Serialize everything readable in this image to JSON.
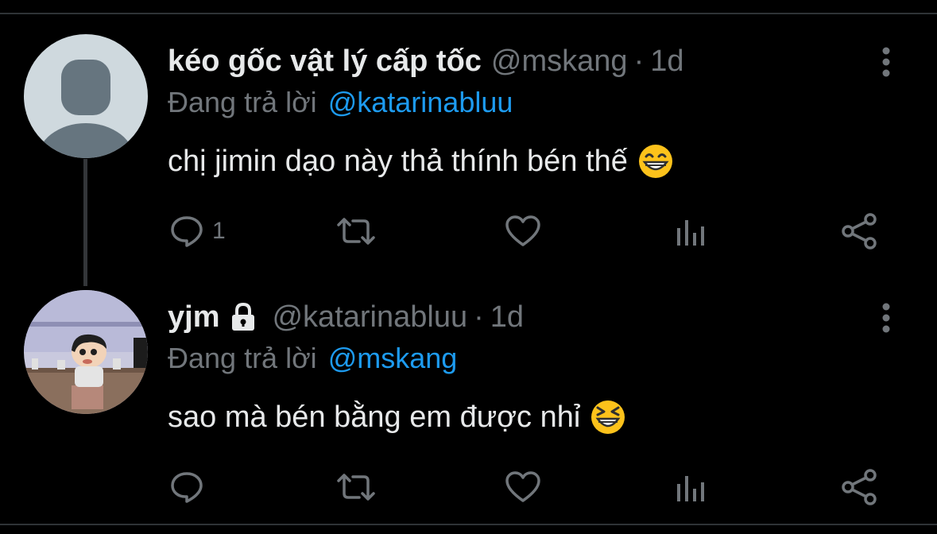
{
  "colors": {
    "background": "#000000",
    "text": "#e7e9ea",
    "muted": "#71767b",
    "link": "#1d9bf0",
    "divider": "#2f3336"
  },
  "tweets": [
    {
      "display_name": "kéo gốc vật lý cấp tốc",
      "handle": "@mskang",
      "separator": "·",
      "time": "1d",
      "reply_prefix": "Đang trả lời",
      "reply_to": "@katarinabluu",
      "text": "chị jimin dạo này thả thính bén thế",
      "emoji": "grinning-face-icon",
      "reply_count": "1",
      "avatar": "default-avatar",
      "locked": false
    },
    {
      "display_name": "yjm",
      "handle": "@katarinabluu",
      "separator": "·",
      "time": "1d",
      "reply_prefix": "Đang trả lời",
      "reply_to": "@mskang",
      "text": "sao mà bén bằng em được nhỉ",
      "emoji": "laughing-squint-face-icon",
      "reply_count": "",
      "avatar": "cartoon-avatar",
      "locked": true
    }
  ]
}
